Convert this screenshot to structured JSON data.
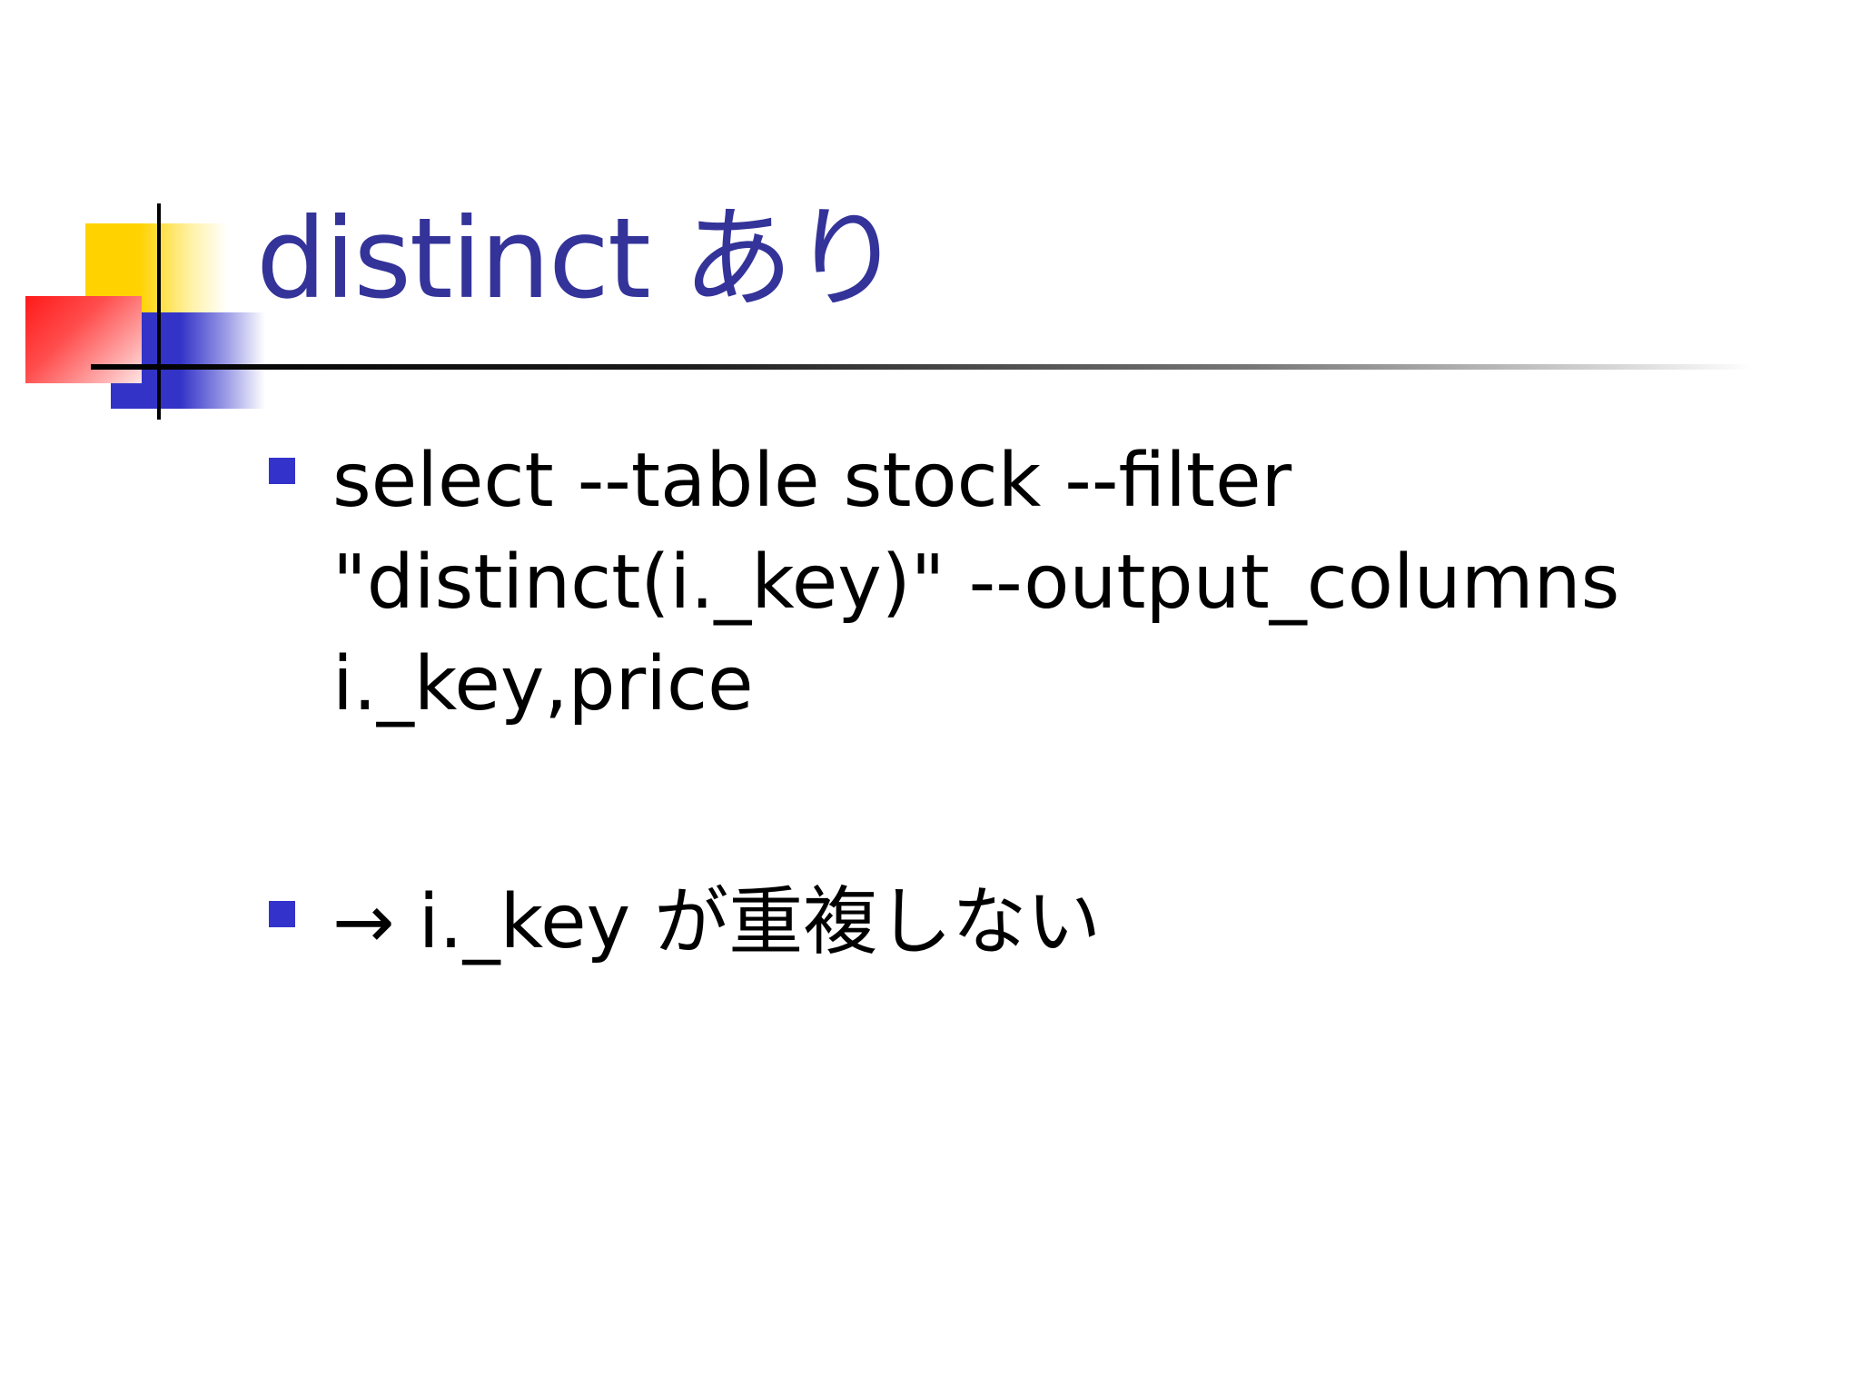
{
  "slide": {
    "title": "distinct あり",
    "title_color": "#333399",
    "bullet_color": "#3333cc",
    "bullets": [
      {
        "text": "select --table stock --filter\n\"distinct(i._key)\" --output_columns\ni._key,price"
      },
      {
        "text": "→ i._key が重複しない"
      }
    ]
  }
}
